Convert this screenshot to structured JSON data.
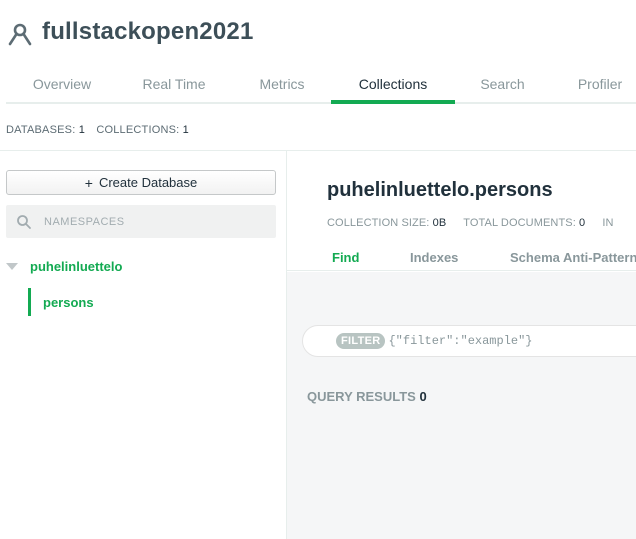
{
  "header": {
    "title": "fullstackopen2021",
    "icon": "cluster-icon"
  },
  "tabs": [
    {
      "label": "Overview",
      "active": false
    },
    {
      "label": "Real Time",
      "active": false
    },
    {
      "label": "Metrics",
      "active": false
    },
    {
      "label": "Collections",
      "active": true
    },
    {
      "label": "Search",
      "active": false
    },
    {
      "label": "Profiler",
      "active": false
    }
  ],
  "stats": {
    "databases_label": "DATABASES:",
    "databases_value": "1",
    "collections_label": "COLLECTIONS:",
    "collections_value": "1"
  },
  "sidebar": {
    "create_db_label": "Create Database",
    "create_db_icon": "+",
    "search_placeholder": "NAMESPACES",
    "database": "puhelinluettelo",
    "collection": "persons"
  },
  "main": {
    "namespace": "puhelinluettelo.persons",
    "collection_size_label": "COLLECTION SIZE:",
    "collection_size_value": "0B",
    "total_documents_label": "TOTAL DOCUMENTS:",
    "total_documents_value": "0",
    "truncated_stat": "IN",
    "subtabs": [
      {
        "label": "Find",
        "active": true
      },
      {
        "label": "Indexes",
        "active": false
      },
      {
        "label": "Schema Anti-Patterns",
        "active": false
      }
    ],
    "filter_label": "FILTER",
    "filter_placeholder": "{\"filter\":\"example\"}",
    "query_results_label": "QUERY RESULTS",
    "query_results_count": "0"
  },
  "colors": {
    "accent": "#13aa52",
    "text_dark": "#21313c",
    "text_muted": "#89979b"
  }
}
